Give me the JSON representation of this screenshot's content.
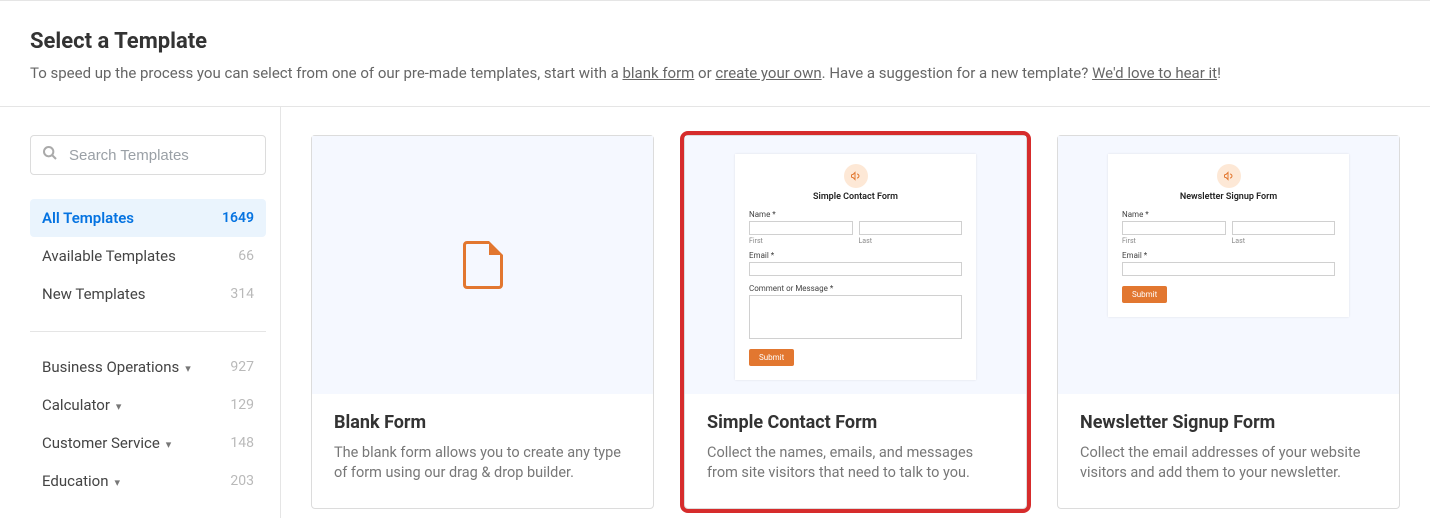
{
  "header": {
    "title": "Select a Template",
    "subtitle_1": "To speed up the process you can select from one of our pre-made templates, start with a ",
    "link_blank": "blank form",
    "subtitle_2": " or ",
    "link_create": "create your own",
    "subtitle_3": ". Have a suggestion for a new template? ",
    "link_feedback": "We'd love to hear it",
    "subtitle_4": "!"
  },
  "search": {
    "placeholder": "Search Templates"
  },
  "filters": [
    {
      "label": "All Templates",
      "count": "1649",
      "selected": true
    },
    {
      "label": "Available Templates",
      "count": "66",
      "selected": false
    },
    {
      "label": "New Templates",
      "count": "314",
      "selected": false
    }
  ],
  "categories": [
    {
      "label": "Business Operations",
      "count": "927"
    },
    {
      "label": "Calculator",
      "count": "129"
    },
    {
      "label": "Customer Service",
      "count": "148"
    },
    {
      "label": "Education",
      "count": "203"
    }
  ],
  "templates": [
    {
      "title": "Blank Form",
      "desc": "The blank form allows you to create any type of form using our drag & drop builder.",
      "highlight": false,
      "previewType": "blank"
    },
    {
      "title": "Simple Contact Form",
      "desc": "Collect the names, emails, and messages from site visitors that need to talk to you.",
      "highlight": true,
      "previewType": "contact",
      "preview": {
        "formTitle": "Simple Contact Form",
        "name": "Name *",
        "first": "First",
        "last": "Last",
        "email": "Email *",
        "comment": "Comment or Message *",
        "submit": "Submit"
      }
    },
    {
      "title": "Newsletter Signup Form",
      "desc": "Collect the email addresses of your website visitors and add them to your newsletter.",
      "highlight": false,
      "previewType": "newsletter",
      "preview": {
        "formTitle": "Newsletter Signup Form",
        "name": "Name *",
        "first": "First",
        "last": "Last",
        "email": "Email *",
        "submit": "Submit"
      }
    }
  ]
}
